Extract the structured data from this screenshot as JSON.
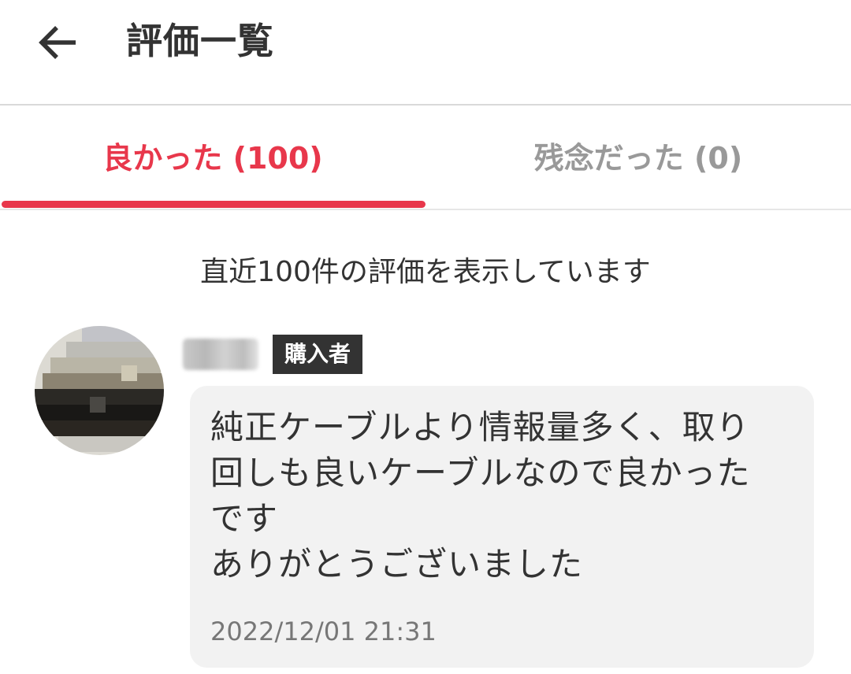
{
  "header": {
    "back_icon": "arrow-left-icon",
    "title": "評価一覧"
  },
  "tabs": {
    "good": {
      "label": "良かった (100)",
      "selected": true
    },
    "bad": {
      "label": "残念だった (0)",
      "selected": false
    },
    "accent_color": "#e8374b"
  },
  "notice": "直近100件の評価を表示しています",
  "review": {
    "badge": "購入者",
    "text": "純正ケーブルより情報量多く、取り\n回しも良いケーブルなので良かった\nです\nありがとうございました",
    "date": "2022/12/01 21:31"
  }
}
